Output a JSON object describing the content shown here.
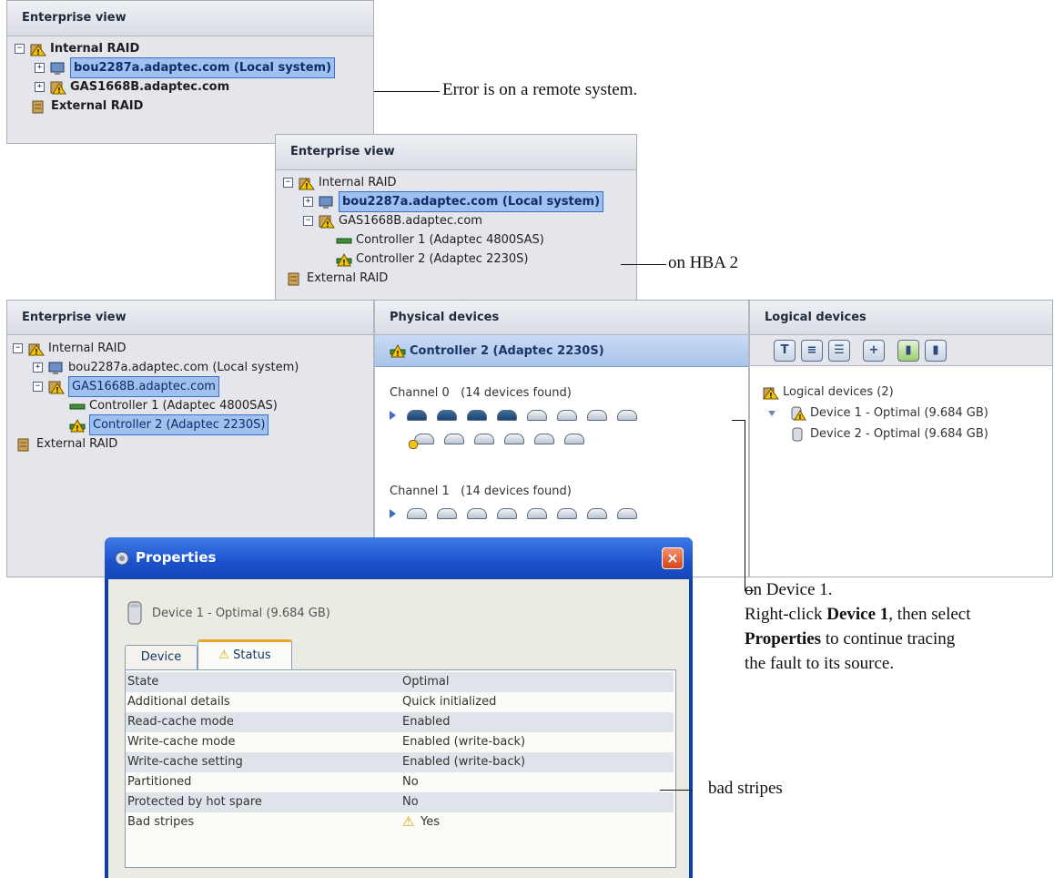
{
  "panel1": {
    "header": "Enterprise view",
    "tree": {
      "internal_raid": "Internal RAID",
      "local_system": "bou2287a.adaptec.com (Local system)",
      "remote_system": "GAS1668B.adaptec.com",
      "external_raid": "External RAID"
    }
  },
  "panel2": {
    "header": "Enterprise view",
    "tree": {
      "internal_raid": "Internal RAID",
      "local_system": "bou2287a.adaptec.com (Local system)",
      "remote_system": "GAS1668B.adaptec.com",
      "controller1": "Controller 1 (Adaptec 4800SAS)",
      "controller2": "Controller 2 (Adaptec 2230S)",
      "external_raid": "External RAID"
    }
  },
  "panel3": {
    "enterprise_header": "Enterprise view",
    "physical_header": "Physical devices",
    "logical_header": "Logical devices",
    "tree": {
      "internal_raid": "Internal RAID",
      "local_system": "bou2287a.adaptec.com (Local system)",
      "remote_system": "GAS1668B.adaptec.com",
      "controller1": "Controller 1 (Adaptec 4800SAS)",
      "controller2": "Controller 2 (Adaptec 2230S)",
      "external_raid": "External RAID"
    },
    "physical": {
      "selected_controller": "Controller 2 (Adaptec 2230S)",
      "channel0": "Channel 0   (14 devices found)",
      "channel1": "Channel 1   (14 devices found)"
    },
    "logical": {
      "toolbar_icons": [
        "text-view-icon",
        "list-view-icon",
        "detail-view-icon",
        "add-icon",
        "create-icon",
        "copy-icon"
      ],
      "root": "Logical devices (2)",
      "device1": "Device 1 - Optimal (9.684 GB)",
      "device2": "Device 2 - Optimal (9.684 GB)"
    }
  },
  "properties": {
    "title": "Properties",
    "device_label": "Device 1 - Optimal (9.684 GB)",
    "tabs": [
      "Device",
      "Status"
    ],
    "rows": [
      {
        "name": "State",
        "value": "Optimal"
      },
      {
        "name": "Additional details",
        "value": "Quick initialized"
      },
      {
        "name": "Read-cache mode",
        "value": "Enabled"
      },
      {
        "name": "Write-cache mode",
        "value": "Enabled (write-back)"
      },
      {
        "name": "Write-cache setting",
        "value": "Enabled (write-back)"
      },
      {
        "name": "Partitioned",
        "value": "No"
      },
      {
        "name": "Protected by hot spare",
        "value": "No"
      },
      {
        "name": "Bad stripes",
        "value": "Yes"
      }
    ]
  },
  "annotations": {
    "remote": "Error is on a remote system.",
    "hba": "on HBA 2",
    "device_line1": "on Device 1.",
    "device_line2_pre": "Right-click ",
    "device_line2_bold": "Device 1",
    "device_line2_post": ", then select",
    "device_line3_bold": "Properties",
    "device_line3_post": " to continue tracing",
    "device_line4": "the fault to its source.",
    "bad_stripes": "bad stripes"
  },
  "colors": {
    "selection": "#9fc1ef",
    "warning": "#f5c400",
    "titlebar": "#1f5bd1"
  }
}
